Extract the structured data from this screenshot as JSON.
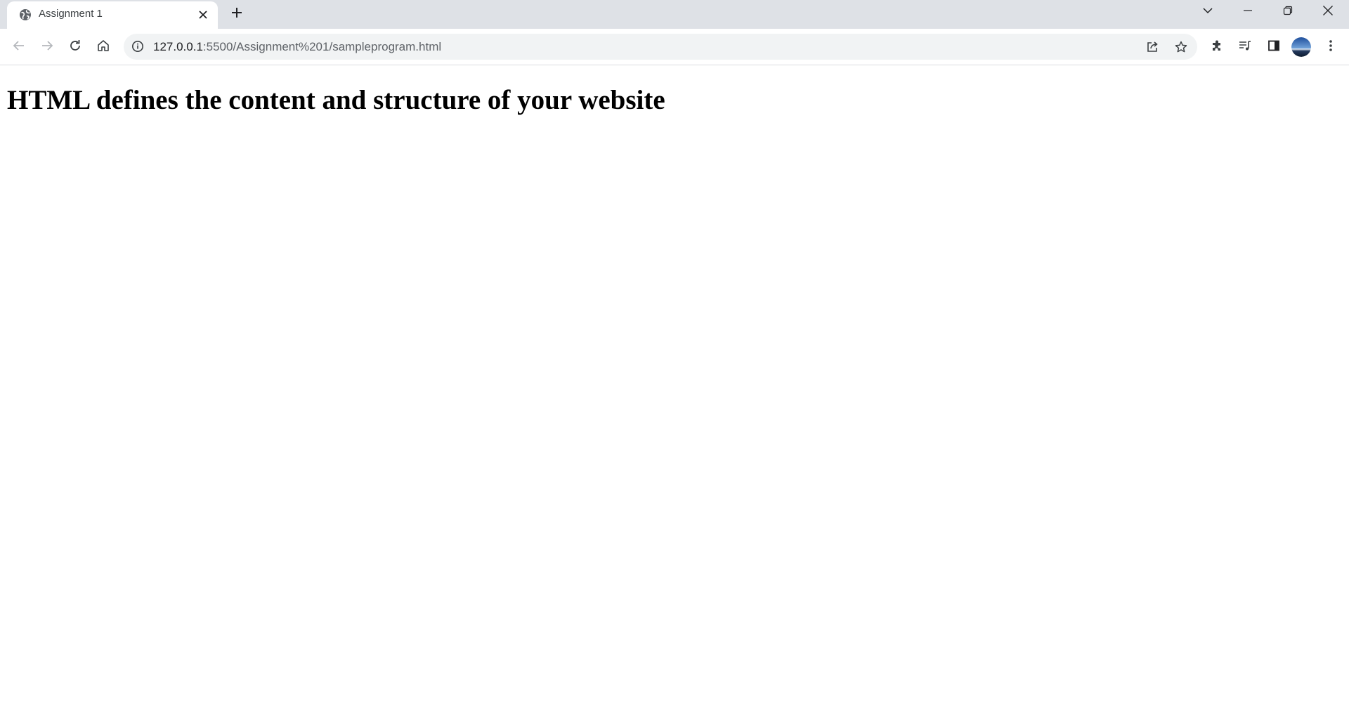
{
  "browser": {
    "tab": {
      "title": "Assignment 1",
      "favicon": "globe-icon",
      "close_icon": "close-icon"
    },
    "new_tab_icon": "plus-icon",
    "window_controls": [
      "chevron-down-icon",
      "minimize-icon",
      "restore-icon",
      "close-icon"
    ],
    "toolbar": {
      "back_icon": "arrow-left-icon",
      "forward_icon": "arrow-right-icon",
      "reload_icon": "reload-icon",
      "home_icon": "home-icon",
      "omnibox": {
        "site_info_icon": "info-icon",
        "url_host": "127.0.0.1",
        "url_path": ":5500/Assignment%201/sampleprogram.html",
        "share_icon": "share-icon",
        "bookmark_icon": "star-icon"
      },
      "extensions_icon": "puzzle-icon",
      "media_icon": "queue-music-icon",
      "side_panel_icon": "side-panel-icon",
      "profile_icon": "avatar",
      "menu_icon": "kebab-menu-icon"
    },
    "colors": {
      "tabstrip": "#dee1e6",
      "omnibox": "#f1f3f4",
      "icon": "#5f6368"
    }
  },
  "page": {
    "heading": "HTML defines the content and structure of your website"
  }
}
